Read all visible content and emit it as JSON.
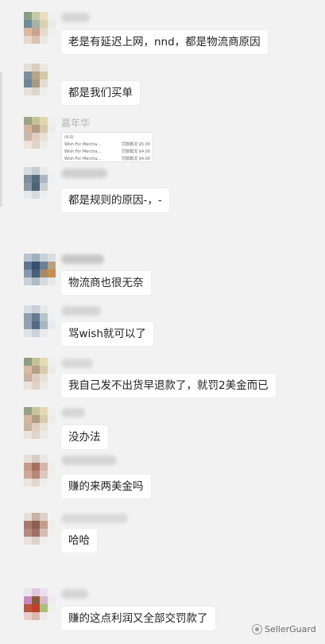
{
  "messages": [
    {
      "text": "老是有延迟上网，nnd，都是物流商原因"
    },
    {
      "text": "都是我们买单"
    },
    {
      "nickname": "嘉年华",
      "screenshot_rows": [
        {
          "item": "Wish For Mercha...",
          "fee": "罚款概况 $5.00"
        },
        {
          "item": "Wish For Mercha...",
          "fee": "罚款概况 $4.00"
        },
        {
          "item": "Wish For Mercha...",
          "fee": "罚款概况 $4.00"
        }
      ],
      "screenshot_header": "(4.0)"
    },
    {
      "text": "都是规则的原因-，-"
    },
    {
      "text": "物流商也很无奈"
    },
    {
      "text": "骂wish就可以了"
    },
    {
      "text": "我自己发不出货早退款了，就罚2美金而已"
    },
    {
      "text": "没办法"
    },
    {
      "text": "赚的来两美金吗"
    },
    {
      "text": "哈哈"
    },
    {
      "text": "赚的这点利润又全部交罚款了"
    }
  ],
  "watermark": {
    "text": "SellerGuard",
    "icon": "wechat-channel-icon"
  }
}
